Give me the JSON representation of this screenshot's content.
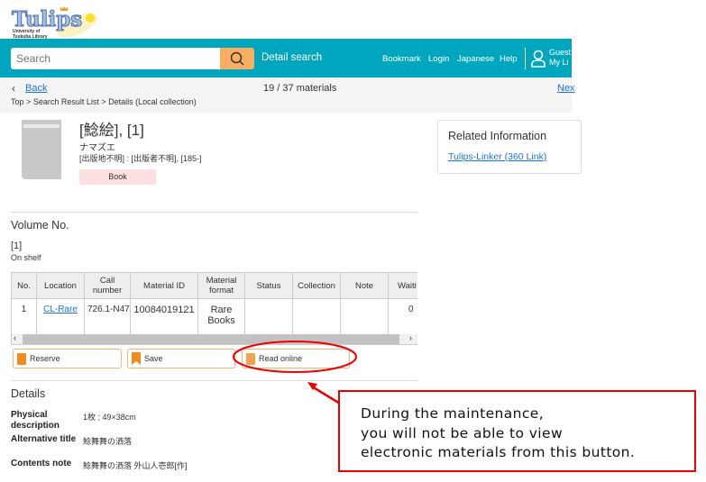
{
  "logo": {
    "text": "Tulips",
    "sub": "University of Tsukuba Library"
  },
  "header": {
    "search_placeholder": "Search",
    "detail_search": "Detail search",
    "links": [
      "Bookmark",
      "Login",
      "Japanese",
      "Help"
    ],
    "user_line1": "Guest",
    "user_line2": "My Li"
  },
  "nav": {
    "back": "Back",
    "count": "19 / 37 materials",
    "next": "Nex",
    "breadcrumb": [
      "Top",
      ">",
      "Search Result List",
      ">",
      "Details (Local collection)"
    ]
  },
  "item": {
    "title": "[鯰絵], [1]",
    "kana": "ナマズエ",
    "publisher": "[出版地不明] : [出版者不明], [185-]",
    "type": "Book"
  },
  "related": {
    "heading": "Related Information",
    "link": "Tulips-Linker (360 Link)"
  },
  "volume": {
    "heading": "Volume No.",
    "number": "[1]",
    "status": "On shelf"
  },
  "table": {
    "headers": [
      "No.",
      "Location",
      "Call number",
      "Material ID",
      "Material format",
      "Status",
      "Collection",
      "Note",
      "Waiti"
    ],
    "rows": [
      [
        "1",
        "CL-Rare",
        "726.1-N47",
        "10084019121",
        "Rare Books",
        "",
        "",
        "",
        "0"
      ]
    ]
  },
  "actions": {
    "reserve": "Reserve",
    "save": "Save",
    "read_online": "Read online"
  },
  "details": {
    "heading": "Details",
    "rows": [
      {
        "label": "Physical description",
        "value": "1枚 ; 49×38cm"
      },
      {
        "label": "Alternative title",
        "value": "鯰舞舞の洒落"
      },
      {
        "label": "Contents note",
        "value": "鯰舞舞の洒落 外山人壱郎[作]"
      }
    ]
  },
  "annotation": {
    "lines": [
      "During the maintenance,",
      "you will not be able to view",
      "electronic materials from this button."
    ],
    "color": "#e00000"
  },
  "colors": {
    "header": "#00a6be",
    "search_button": "#f9ad5f",
    "accent": "#f08c1e"
  }
}
